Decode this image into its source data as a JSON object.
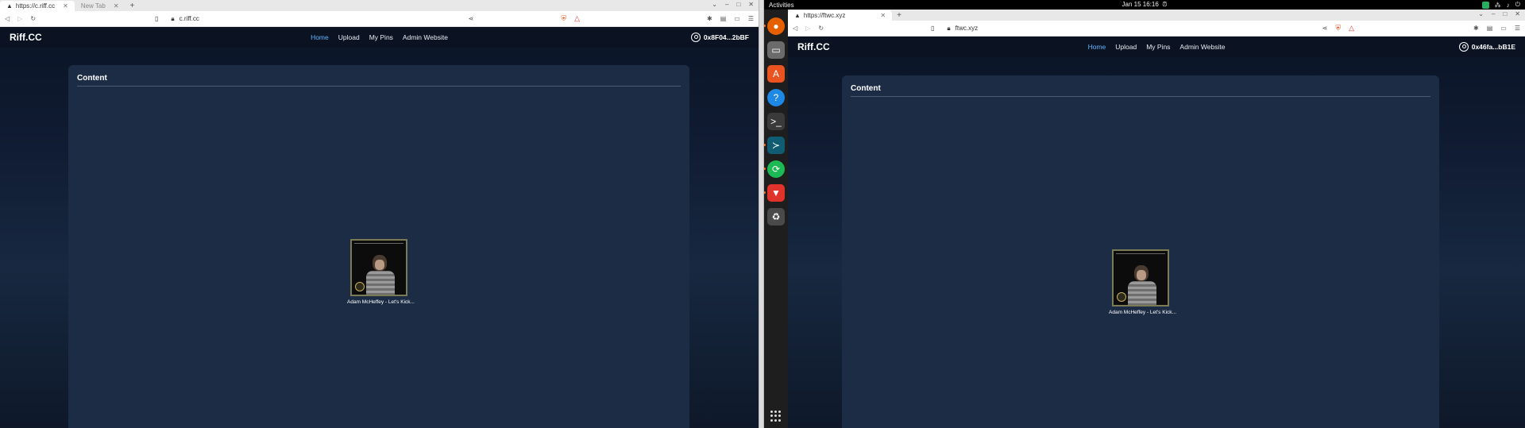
{
  "left": {
    "tabs": [
      {
        "label": "https://c.riff.cc",
        "active": true
      },
      {
        "label": "New Tab",
        "active": false
      }
    ],
    "url": "c.riff.cc",
    "site": {
      "logo": "Riff.CC",
      "nav": [
        "Home",
        "Upload",
        "My Pins",
        "Admin Website"
      ],
      "wallet": "0x8F04...2bBF",
      "section_title": "Content",
      "card_title": "Adam McHeffey - Let's Kick..."
    }
  },
  "right": {
    "topbar": {
      "activities": "Activities",
      "clock": "Jan 15  16:16"
    },
    "tabs": [
      {
        "label": "https://ftwc.xyz",
        "active": true
      }
    ],
    "url": "ftwc.xyz",
    "site": {
      "logo": "Riff.CC",
      "nav": [
        "Home",
        "Upload",
        "My Pins",
        "Admin Website"
      ],
      "wallet": "0x46fa...bB1E",
      "section_title": "Content",
      "card_title": "Adam McHeffey - Let's Kick..."
    },
    "dock": [
      {
        "icon": "firefox-icon",
        "color": "#e66000"
      },
      {
        "icon": "files-icon",
        "color": "#5a5a5a"
      },
      {
        "icon": "app-center-icon",
        "color": "#e95420"
      },
      {
        "icon": "help-icon",
        "color": "#1e88e5"
      },
      {
        "icon": "terminal-icon",
        "color": "#333333"
      },
      {
        "icon": "vscode-icon",
        "color": "#0f5c73"
      },
      {
        "icon": "sync-icon",
        "color": "#1db954"
      },
      {
        "icon": "brave-icon",
        "color": "#e0332b"
      },
      {
        "icon": "trash-icon",
        "color": "#4a4a4a"
      }
    ]
  },
  "colors": {
    "nav_active": "#5fb3ff",
    "panel": "#1c2c45",
    "page_bg": "#0a1426"
  }
}
